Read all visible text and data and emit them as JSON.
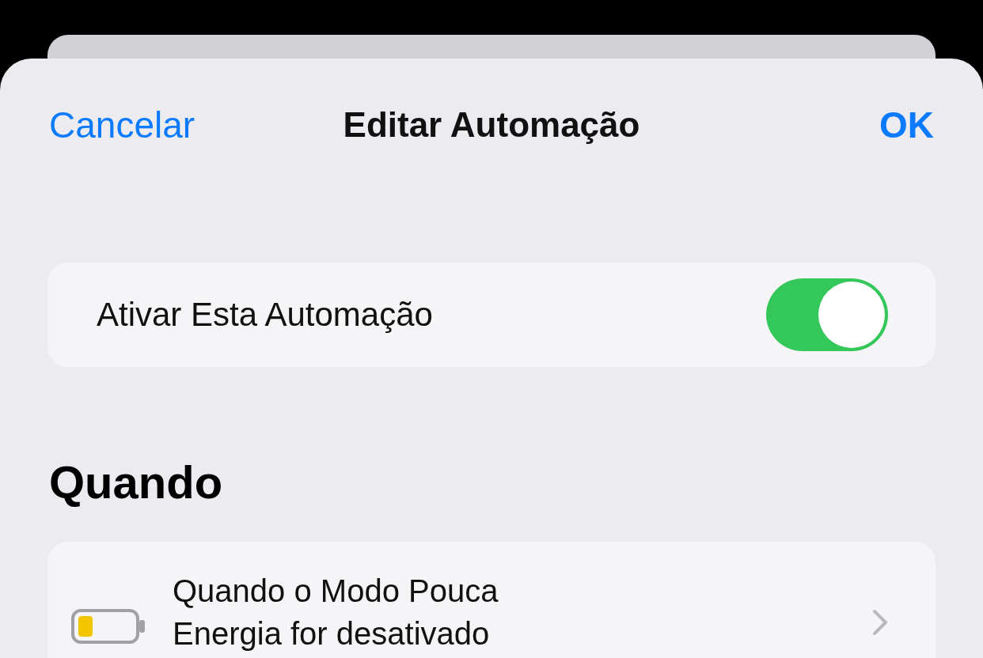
{
  "nav": {
    "cancel": "Cancelar",
    "title": "Editar Automação",
    "ok": "OK"
  },
  "enable_row": {
    "label": "Ativar Esta Automação",
    "on": true
  },
  "section": {
    "title": "Quando"
  },
  "trigger": {
    "text": "Quando o Modo Pouca Energia for desativado"
  }
}
